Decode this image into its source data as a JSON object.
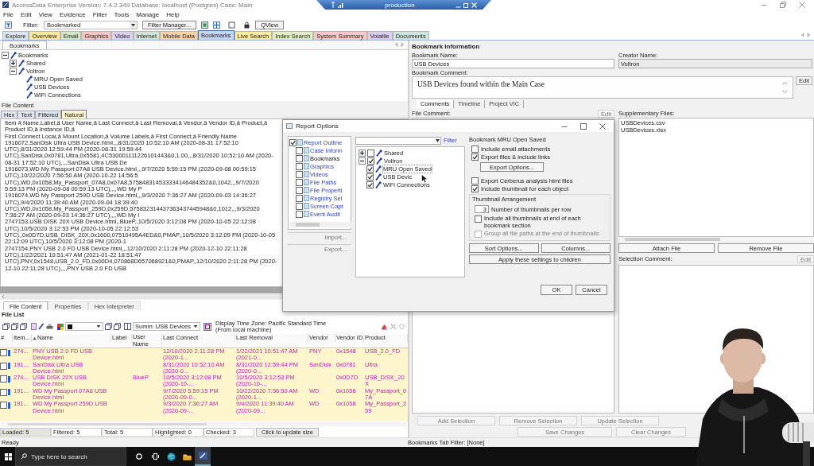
{
  "window": {
    "title": "AccessData Enterprise Version: 7.4.2.349 Database: localhost (Postgres) Case: Main"
  },
  "remote_bar": {
    "title": "production"
  },
  "menu": [
    "File",
    "Edit",
    "View",
    "Evidence",
    "Filter",
    "Tools",
    "Manage",
    "Help"
  ],
  "toolbar": {
    "filter_label": "Filter:",
    "filter_value": "Bookmarked",
    "filter_manager": "Filter Manager...",
    "qview": "QView"
  },
  "tabs": [
    {
      "label": "Explore",
      "color": "#dbe4ef",
      "selected": false
    },
    {
      "label": "Overview",
      "color": "#f7e7a1",
      "selected": false
    },
    {
      "label": "Email",
      "color": "#d3e6c8",
      "selected": false
    },
    {
      "label": "Graphics",
      "color": "#f3c6c6",
      "selected": false
    },
    {
      "label": "Video",
      "color": "#ddd0ef",
      "selected": false
    },
    {
      "label": "Internet",
      "color": "#d3e3d9",
      "selected": false
    },
    {
      "label": "Mobile Data",
      "color": "#f6d2a8",
      "selected": false
    },
    {
      "label": "Bookmarks",
      "color": "#c6d6f0",
      "selected": true
    },
    {
      "label": "Live Search",
      "color": "#f8eaa0",
      "selected": false
    },
    {
      "label": "Index Search",
      "color": "#e1edc4",
      "selected": false
    },
    {
      "label": "System Summary",
      "color": "#f5c9c9",
      "selected": false
    },
    {
      "label": "Volatile",
      "color": "#dccdf0",
      "selected": false
    },
    {
      "label": "Documents",
      "color": "#cfe5e0",
      "selected": false
    }
  ],
  "bookmarks_panel": {
    "tab": "Bookmarks",
    "tree": [
      {
        "label": "Bookmarks",
        "expanded": true,
        "children": [
          {
            "label": "Shared",
            "expanded": false
          },
          {
            "label": "Voltron",
            "expanded": true,
            "children": [
              {
                "label": "MRU Open Saved"
              },
              {
                "label": "USB Devices"
              },
              {
                "label": "WiFi Connections"
              }
            ]
          }
        ]
      }
    ]
  },
  "file_content": {
    "title": "File Content",
    "view_tabs": [
      {
        "label": "Hex",
        "selected": false
      },
      {
        "label": "Text",
        "selected": false
      },
      {
        "label": "Filtered",
        "selected": false
      },
      {
        "label": "Natural",
        "selected": true
      }
    ],
    "lines": [
      "Item #,Name,Label,ä     User Name,ä     Last Connect,ä     Last Removal,ä     Vendor,ä     Vendor ID,ä     Product,ä     Product ID,ä     Instance ID,ä",
      "First Connect Local,ä     Mount Location,ä     Volume Labels,ä     First Connect,ä     Friendly Name",
      "1916072,SanDisk Ultra USB Device.html,,,8/31/2020 10:52:10 AM (2020-08-31 17:52:10 UTC),8/31/2020 12:59:44 PM (2020-08-31 19:59:44",
      "UTC),SanDisk,0x0781,Ultra,0x5581,4C530001111226101443&0,1.00,,,8/31/2020 10:52:10 AM (2020-08-31 17:52:10 UTC),,,,SanDisk Ultra USB De",
      "1916073,WD My Passport 07A8 USB Device.html,,,9/7/2020 5:59:15 PM (2020-09-08 00:59:15 UTC),10/22/2020 7:56:50 AM (2020-10-22 14:56:5",
      "UTC),WD,0x1058,My_Passport_07A8,0x07A8,575848314533334146484352&0,1042,,,9/7/2020 5:59:13 PM (2020-09-08 00:59:13 UTC),,,,WD My P",
      "1916074,WD My Passport 259D USB Device.html,,,9/3/2020 7:36:27 AM (2020-09-03 14:36:27 UTC),9/4/2020 11:39:40 AM (2020-09-04 18:39:40",
      "UTC),WD,0x1058,My_Passport_259D,0x259D,575832314437363437445948&0,1012,,,9/3/2020 7:36:27 AM (2020-09-03 14:36:27 UTC),,,,WD My I",
      "2747153,USB DISK 20X USB Device.html,,BlueP,,10/5/2020 3:12:08 PM (2020-10-05 22:12:08 UTC),10/5/2020 3:12:53 PM (2020-10-05 22:12:53",
      "UTC),,0x0D7D,USB_DISK_20X,0x1600,07510495A4ED&0,PMAP,,10/5/2020 3:12:09 PM (2020-10-05 22:12:09 UTC),10/5/2020 3:12:08 PM (2020-1",
      "2747154,PNY USB 2.0 FD USB Device.html,,,12/10/2020 2:11:28 PM (2020-12-10 22:11:28 UTC),1/22/2021 10:51:47 AM (2021-01-22 18:51:47",
      "UTC),PNY,0x1548,USB_2.0_FD,0x00D4,070868D657068921&0,PMAP,,12/10/2020 2:11:28 PM (2020-12-10 22:11:28 UTC),,,,PNY USB 2.0 FD USB"
    ]
  },
  "detail_tabs": [
    {
      "label": "File Content",
      "selected": true
    },
    {
      "label": "Properties",
      "selected": false
    },
    {
      "label": "Hex Interpreter",
      "selected": false
    }
  ],
  "file_list": {
    "title": "File List",
    "summary": "Summ:  USB Devices",
    "time_zone": "Display Time Zone: Pacific Standard Time  (From local machine)",
    "check_column": "#",
    "columns": [
      {
        "label": "Item...",
        "sorted": false
      },
      {
        "label": "Name",
        "sorted": true
      },
      {
        "label": "Label",
        "sorted": false
      },
      {
        "label": "User Name",
        "sorted": false
      },
      {
        "label": "Last Connect",
        "sorted": false
      },
      {
        "label": "Last Removal",
        "sorted": false
      },
      {
        "label": "Vendor",
        "sorted": false
      },
      {
        "label": "Vendor ID",
        "sorted": false
      },
      {
        "label": "Product",
        "sorted": false
      }
    ],
    "rows": [
      {
        "checked": false,
        "item": "274...",
        "name": "PNY USB 2.0 FD USB Device.html",
        "last_connect": "12/10/2020 2:11:28 PM (2020-1...",
        "last_removal": "1/22/2021 10:51:47 AM (2021-0...",
        "vendor": "PNY",
        "vendor_id": "0x1548",
        "product": "USB_2.0_FD"
      },
      {
        "checked": false,
        "item": "191...",
        "name": "SanDisk Ultra USB Device.html",
        "last_connect": "8/31/2020 10:52:10 AM (2020-0...",
        "last_removal": "8/31/2020 12:59:44 PM (2020-0...",
        "vendor": "SanDisk",
        "vendor_id": "0x0781",
        "product": "Ultra"
      },
      {
        "checked": false,
        "item": "274...",
        "name": "USB DISK 20X USB Device.html",
        "user_name": "BlueP",
        "last_connect": "10/5/2020 3:12:08 PM (2020-10-...",
        "last_removal": "10/5/2020 3:12:53 PM (2020-10-...",
        "vendor_id": "0x0D7D",
        "product": "USB_DISK_20X"
      },
      {
        "checked": false,
        "item": "191...",
        "name": "WD My Passport 07A8 USB Device.html",
        "last_connect": "9/7/2020 5:59:15 PM (2020-09-0...",
        "last_removal": "10/22/2020 7:56:50 AM (2020-1...",
        "vendor": "WD",
        "vendor_id": "0x1058",
        "product": "My_Passport_07A"
      },
      {
        "checked": false,
        "item": "191...",
        "name": "WD My Passport 259D USB Device.html",
        "last_connect": "9/3/2020 7:36:27 AM (2020-09-...",
        "last_removal": "9/4/2020 11:39:40 AM (2020-09...",
        "vendor": "WD",
        "vendor_id": "0x1058",
        "product": "My_Passport_259"
      }
    ],
    "counts": [
      "Loaded: 5",
      "Filtered: 5",
      "Total: 5",
      "Highlighted: 0",
      "Checked: 3"
    ],
    "update_button": "Click to update size"
  },
  "bookmark_info": {
    "title": "Bookmark Information",
    "name_label": "Bookmark Name:",
    "name": "USB Devices",
    "creator_label": "Creator Name:",
    "creator": "Voltron",
    "comment_label": "Bookmark Comment:",
    "comment": "USB Devices found within the Main Case",
    "edit": "Edit",
    "tabs": [
      {
        "label": "Comments",
        "selected": true
      },
      {
        "label": "Timeline",
        "selected": false
      },
      {
        "label": "Project VIC",
        "selected": false
      }
    ],
    "file_comment_label": "File Comment:",
    "file_comment_edit": "Edit",
    "supplementary_label": "Supplementary Files:",
    "supplementary_files": [
      "USBDevices.csv",
      "USBDevices.xlsx"
    ],
    "attach": "Attach File",
    "remove": "Remove File",
    "selection_label": "Selection Comment:",
    "selection_edit": "Edit",
    "selection_buttons": [
      {
        "label": "Add Selection",
        "disabled": true
      },
      {
        "label": "Remove Selection",
        "disabled": true
      },
      {
        "label": "Update Selection",
        "disabled": true
      }
    ],
    "change_buttons": [
      {
        "label": "Save Changes",
        "disabled": true
      },
      {
        "label": "Clear Changes",
        "disabled": true
      }
    ]
  },
  "dialog": {
    "title": "Report Options",
    "outline": [
      {
        "label": "Report Outline",
        "checked": true,
        "selected": false
      },
      {
        "label": "Case Inform",
        "checked": false,
        "selected": false
      },
      {
        "label": "Bookmarks",
        "checked": false,
        "selected": true
      },
      {
        "label": "Graphics",
        "checked": false,
        "selected": false
      },
      {
        "label": "Videos",
        "checked": false,
        "selected": false
      },
      {
        "label": "File Paths",
        "checked": false,
        "selected": false
      },
      {
        "label": "File Properti",
        "checked": false,
        "selected": false
      },
      {
        "label": "Registry Sel",
        "checked": false,
        "selected": false
      },
      {
        "label": "Screen Capt",
        "checked": false,
        "selected": false
      },
      {
        "label": "Event Audit",
        "checked": false,
        "selected": false
      }
    ],
    "import": "Import...",
    "export": "Export...",
    "filter_link": "Filter",
    "tree": [
      {
        "label": "Shared",
        "checked": false,
        "expanded": false,
        "selected": false
      },
      {
        "label": "Voltron",
        "checked": true,
        "expanded": true,
        "selected": false,
        "children": [
          {
            "label": "MRU Open Saved",
            "checked": true,
            "selected": true
          },
          {
            "label": "USB Devic",
            "checked": true,
            "selected": false
          },
          {
            "label": "WiFi Connections",
            "checked": true,
            "selected": false
          }
        ]
      }
    ],
    "group_title": "Bookmark MRU Open Saved",
    "options": [
      {
        "kind": "checkbox",
        "label": "Include email attachments",
        "checked": false
      },
      {
        "kind": "checkbox",
        "label": "Export files & include links",
        "checked": true
      },
      {
        "kind": "button",
        "label": "Export Options..."
      },
      {
        "kind": "checkbox",
        "label": "Export Cerberus analysis html files",
        "checked": false
      },
      {
        "kind": "checkbox",
        "label": "Include thumbnail for each object",
        "checked": true
      }
    ],
    "thumbnail": {
      "title": "Thumbnail Arrangement",
      "per_row": "3",
      "per_row_label": "Number of thumbnails per row",
      "options": [
        {
          "label": "Include all thumbnails at end of each bookmark section",
          "checked": false,
          "disabled": false
        },
        {
          "label": "Group all file paths at the end of thumbnails",
          "checked": false,
          "disabled": true
        }
      ]
    },
    "sort": "Sort Options...",
    "columns": "Columns...",
    "apply": "Apply these settings to children",
    "ok": "OK",
    "cancel": "Cancel"
  },
  "status_bar": {
    "left": "Ready",
    "right": "Bookmarks Tab Filter: [None]"
  },
  "taskbar": {
    "search_placeholder": "Type here to search"
  },
  "webcam": {
    "kind": "picture"
  }
}
